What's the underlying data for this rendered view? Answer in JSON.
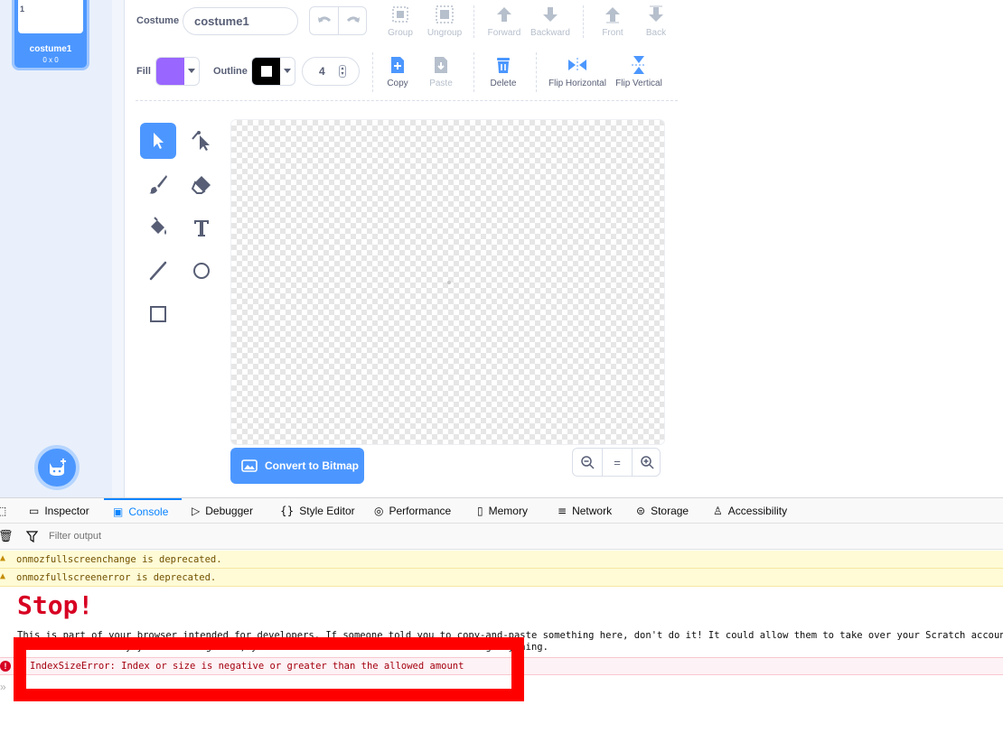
{
  "costume_list": {
    "item_number": "1",
    "item_name": "costume1",
    "item_size": "0 x 0"
  },
  "toolbar": {
    "costume_label": "Costume",
    "costume_name": "costume1",
    "group": "Group",
    "ungroup": "Ungroup",
    "forward": "Forward",
    "backward": "Backward",
    "front": "Front",
    "back": "Back",
    "fill_label": "Fill",
    "fill_color": "#9966ff",
    "outline_label": "Outline",
    "outline_color": "#000000",
    "stroke_width": "4",
    "copy": "Copy",
    "paste": "Paste",
    "delete": "Delete",
    "flip_horizontal": "Flip Horizontal",
    "flip_vertical": "Flip Vertical"
  },
  "canvas": {
    "convert_button": "Convert to Bitmap",
    "zoom_reset": "="
  },
  "devtools": {
    "tabs": [
      "Inspector",
      "Console",
      "Debugger",
      "Style Editor",
      "Performance",
      "Memory",
      "Network",
      "Storage",
      "Accessibility"
    ],
    "active_tab": "Console",
    "filter_placeholder": "Filter output",
    "warnings": [
      "onmozfullscreenchange is deprecated.",
      "onmozfullscreenerror is deprecated."
    ],
    "stop_title": "Stop!",
    "self_xss_line1": "This is part of your browser intended for developers. If someone told you to copy-and-paste something here, don't do it! It could allow them to take over your Scratch account",
    "self_xss_line2": "Scratch what exactly you are doing here, you should close this window without doing anything.",
    "error_message": "IndexSizeError: Index or size is negative or greater than the allowed amount"
  },
  "colors": {
    "accent": "#4c97ff",
    "highlight_box": "#ff0000",
    "error_text": "#a4000f"
  }
}
